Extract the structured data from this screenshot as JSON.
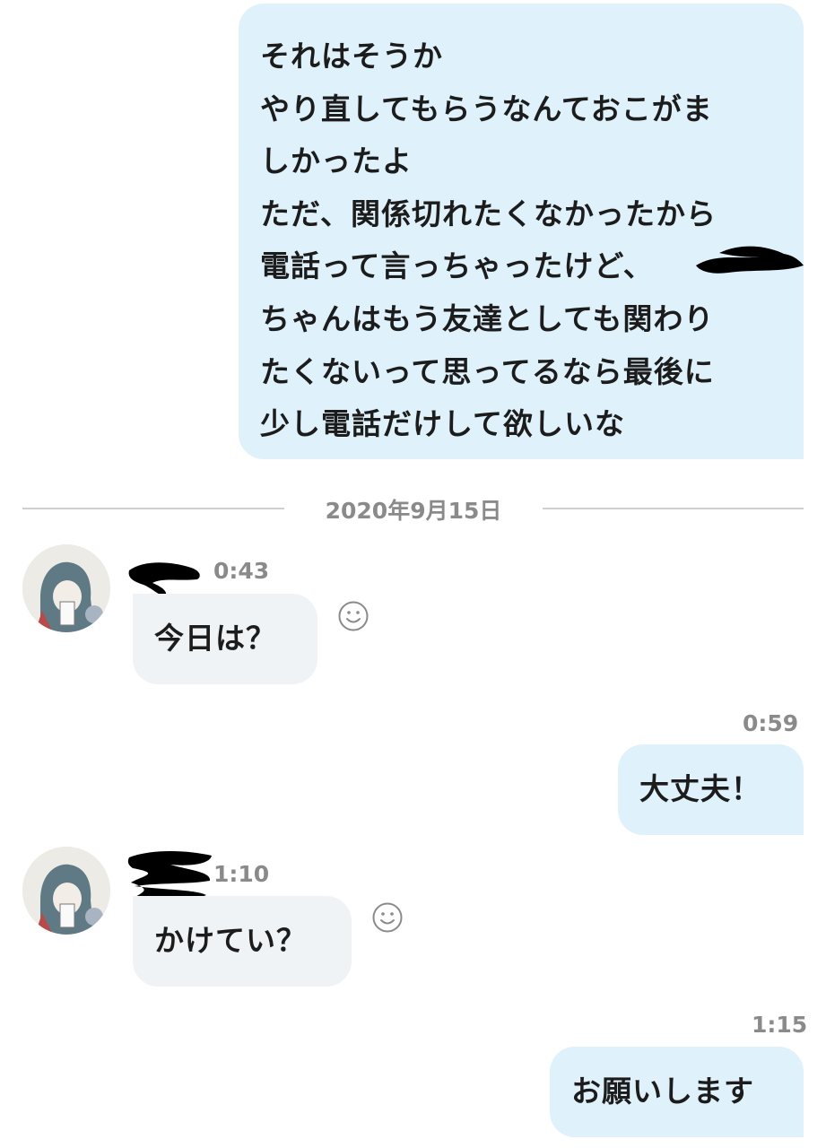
{
  "messages": [
    {
      "direction": "sent",
      "lines": [
        "それはそうか",
        "やり直してもらうなんておこがま",
        "しかったよ",
        "ただ、関係切れたくなかったから",
        "電話って言っちゃったけど、",
        "ちゃんはもう友達としても関わり",
        "たくないって思ってるなら最後に",
        "少し電話だけして欲しいな"
      ]
    },
    {
      "direction": "received",
      "time": "0:43",
      "text": "今日は？"
    },
    {
      "direction": "sent",
      "time": "0:59",
      "text": "大丈夫！"
    },
    {
      "direction": "received",
      "time": "1:10",
      "text": "かけてい？"
    },
    {
      "direction": "sent",
      "time": "1:15",
      "text": "お願いします"
    }
  ],
  "date_separator": "2020年9月15日",
  "colors": {
    "sent_bubble": "#dff1fa",
    "received_bubble": "#f0f3f6",
    "timestamp": "#8a8a8a"
  },
  "icons": {
    "reaction": "smiley-face-icon",
    "avatar": "user-avatar"
  }
}
